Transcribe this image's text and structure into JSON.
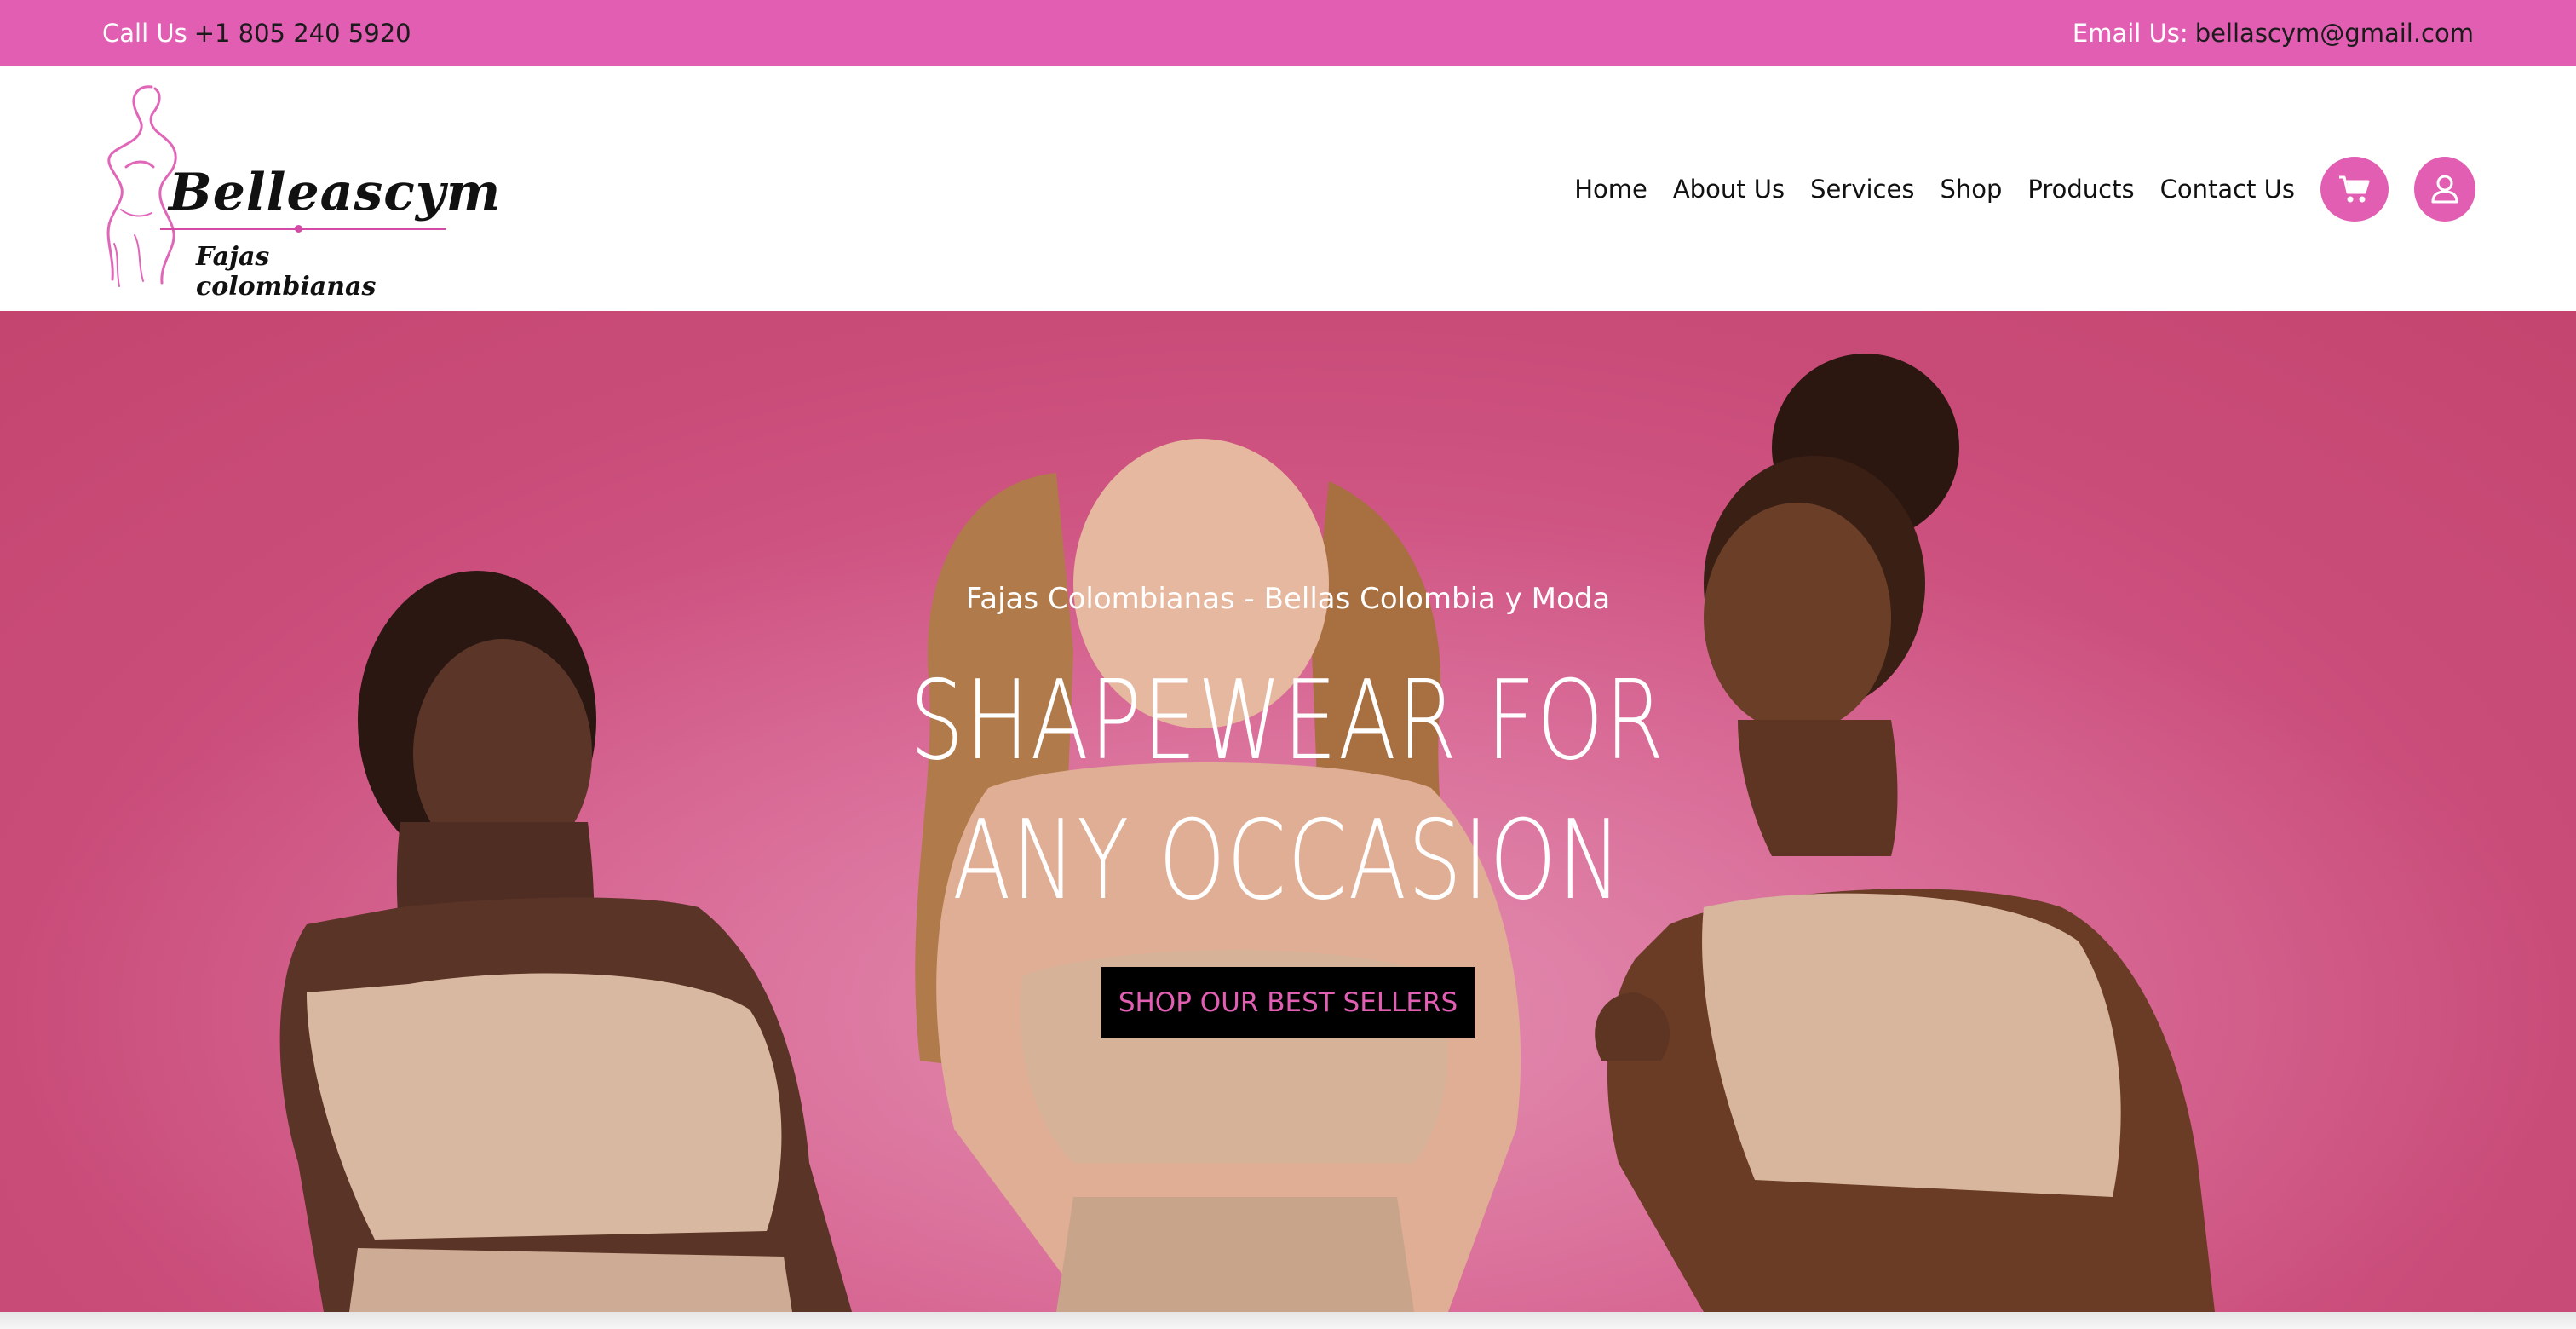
{
  "topbar": {
    "call_label": "Call Us",
    "call_value": "+1 805 240 5920",
    "email_label": "Email Us:",
    "email_value": "bellascym@gmail.com"
  },
  "logo": {
    "brand": "Belleascym",
    "tagline": "Fajas colombianas"
  },
  "nav": {
    "items": [
      "Home",
      "About Us",
      "Services",
      "Shop",
      "Products",
      "Contact Us"
    ],
    "cart_icon": "cart-icon",
    "account_icon": "user-icon"
  },
  "hero": {
    "subtitle": "Fajas Colombianas - Bellas Colombia y Moda",
    "title_line1": "SHAPEWEAR FOR",
    "title_line2": "ANY OCCASION",
    "cta": "SHOP OUR BEST SELLERS"
  },
  "colors": {
    "accent": "#e15eb3",
    "hero_bg": "#c94b78",
    "text_dark": "#111111",
    "cta_bg": "#000000"
  }
}
